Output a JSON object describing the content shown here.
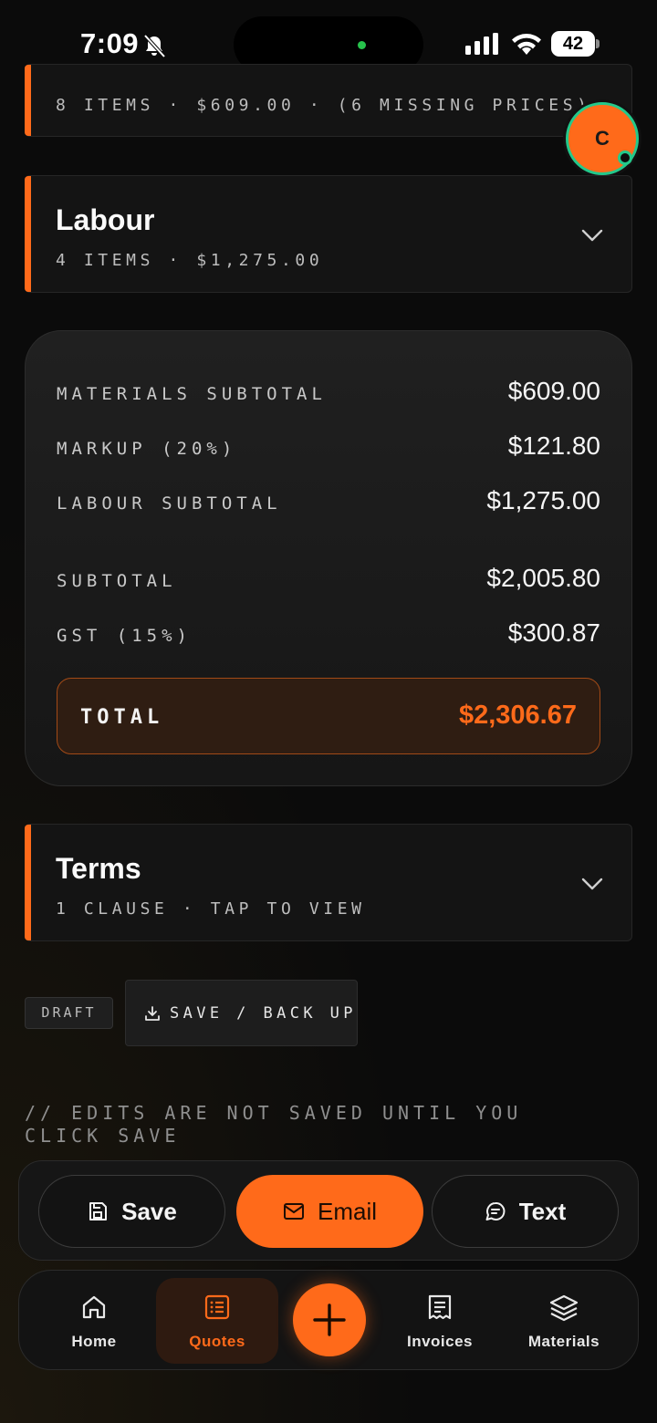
{
  "status_bar": {
    "time": "7:09",
    "battery": "42"
  },
  "user": {
    "avatar_initial": "C"
  },
  "materials_section": {
    "meta": "8 ITEMS · $609.00 · (6 MISSING PRICES)"
  },
  "labour_section": {
    "title": "Labour",
    "meta": "4 ITEMS · $1,275.00"
  },
  "totals": {
    "rows": [
      {
        "label": "MATERIALS SUBTOTAL",
        "value": "$609.00"
      },
      {
        "label": "MARKUP (20%)",
        "value": "$121.80"
      },
      {
        "label": "LABOUR SUBTOTAL",
        "value": "$1,275.00"
      },
      {
        "label": "SUBTOTAL",
        "value": "$2,005.80"
      },
      {
        "label": "GST (15%)",
        "value": "$300.87"
      }
    ],
    "total_label": "TOTAL",
    "total_value": "$2,306.67"
  },
  "terms_section": {
    "title": "Terms",
    "meta": "1 CLAUSE · TAP TO VIEW"
  },
  "status": {
    "draft_label": "DRAFT",
    "save_backup_label": "SAVE / BACK UP"
  },
  "note": "// EDITS ARE NOT SAVED UNTIL YOU CLICK SAVE",
  "actions": {
    "save": "Save",
    "email": "Email",
    "text": "Text"
  },
  "nav": {
    "items": [
      {
        "label": "Home",
        "icon": "home-icon"
      },
      {
        "label": "Quotes",
        "icon": "list-icon"
      },
      {
        "label": "Invoices",
        "icon": "receipt-icon"
      },
      {
        "label": "Materials",
        "icon": "layers-icon"
      }
    ],
    "fab_icon": "plus-icon"
  },
  "colors": {
    "accent": "#ff6a1a",
    "background": "#0b0b0b",
    "card": "#141414",
    "online": "#23c98b"
  }
}
